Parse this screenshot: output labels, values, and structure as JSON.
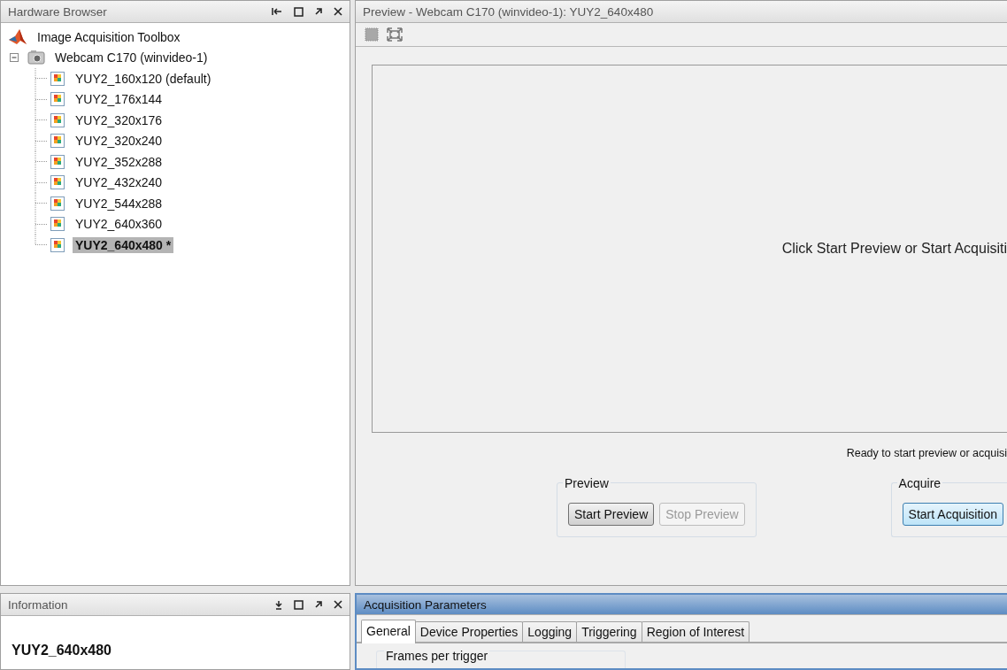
{
  "hardware_browser": {
    "title": "Hardware Browser",
    "tree": [
      {
        "label": "Image Acquisition Toolbox",
        "kind": "toolbox",
        "children": [
          {
            "label": "Webcam C170 (winvideo-1)",
            "kind": "camera",
            "expanded": true,
            "children": [
              {
                "label": "YUY2_160x120 (default)",
                "kind": "format",
                "selected": false
              },
              {
                "label": "YUY2_176x144",
                "kind": "format",
                "selected": false
              },
              {
                "label": "YUY2_320x176",
                "kind": "format",
                "selected": false
              },
              {
                "label": "YUY2_320x240",
                "kind": "format",
                "selected": false
              },
              {
                "label": "YUY2_352x288",
                "kind": "format",
                "selected": false
              },
              {
                "label": "YUY2_432x240",
                "kind": "format",
                "selected": false
              },
              {
                "label": "YUY2_544x288",
                "kind": "format",
                "selected": false
              },
              {
                "label": "YUY2_640x360",
                "kind": "format",
                "selected": false
              },
              {
                "label": "YUY2_640x480 *",
                "kind": "format",
                "selected": true
              }
            ]
          }
        ]
      }
    ]
  },
  "preview": {
    "title": "Preview - Webcam C170 (winvideo-1): YUY2_640x480",
    "message": "Click Start Preview or Start Acquisiti",
    "status": "Ready to start preview or acquisi",
    "groups": [
      {
        "label": "Preview",
        "buttons": [
          {
            "label": "Start Preview",
            "disabled": false,
            "focused": false
          },
          {
            "label": "Stop Preview",
            "disabled": true,
            "focused": false
          }
        ]
      },
      {
        "label": "Acquire",
        "buttons": [
          {
            "label": "Start Acquisition",
            "disabled": false,
            "focused": true
          }
        ]
      }
    ]
  },
  "information": {
    "title": "Information",
    "heading": "YUY2_640x480"
  },
  "acquisition_parameters": {
    "title": "Acquisition Parameters",
    "active": true,
    "tabs": [
      {
        "label": "General",
        "selected": true
      },
      {
        "label": "Device Properties",
        "selected": false
      },
      {
        "label": "Logging",
        "selected": false
      },
      {
        "label": "Triggering",
        "selected": false
      },
      {
        "label": "Region of Interest",
        "selected": false
      }
    ],
    "group_label": "Frames per trigger"
  }
}
